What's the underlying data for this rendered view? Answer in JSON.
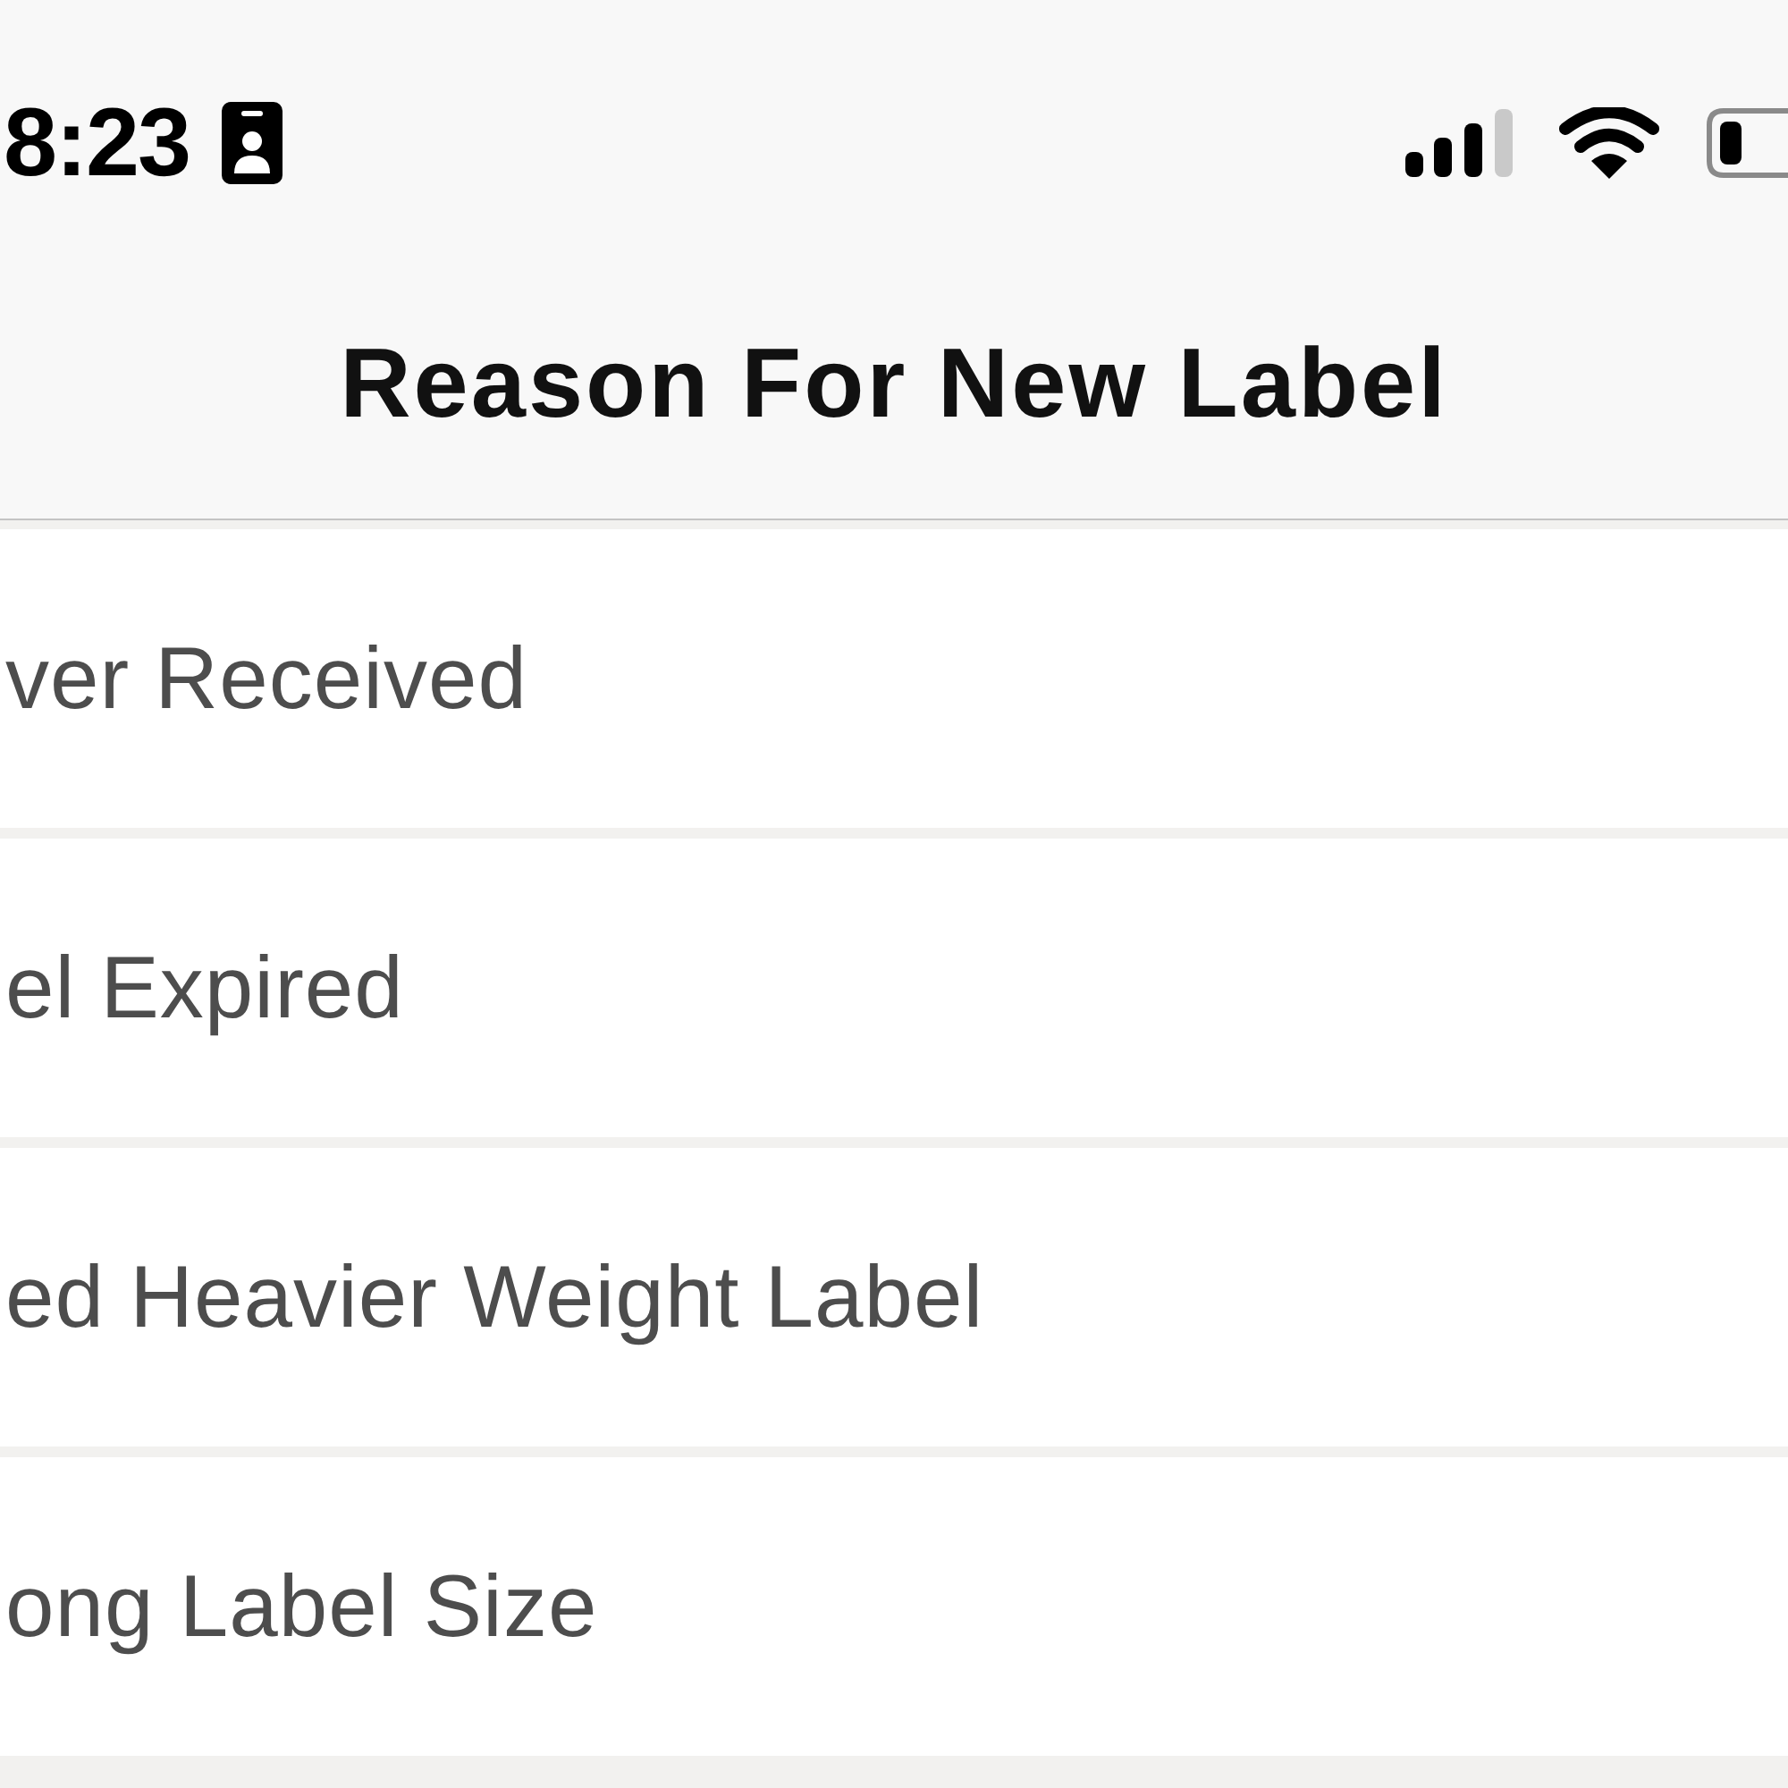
{
  "status_bar": {
    "time": "8:23"
  },
  "nav_bar": {
    "title": "Reason For New Label"
  },
  "reasons": [
    {
      "label": "ver Received"
    },
    {
      "label": "el Expired"
    },
    {
      "label": "ed Heavier Weight Label"
    },
    {
      "label": "ong Label Size"
    }
  ]
}
